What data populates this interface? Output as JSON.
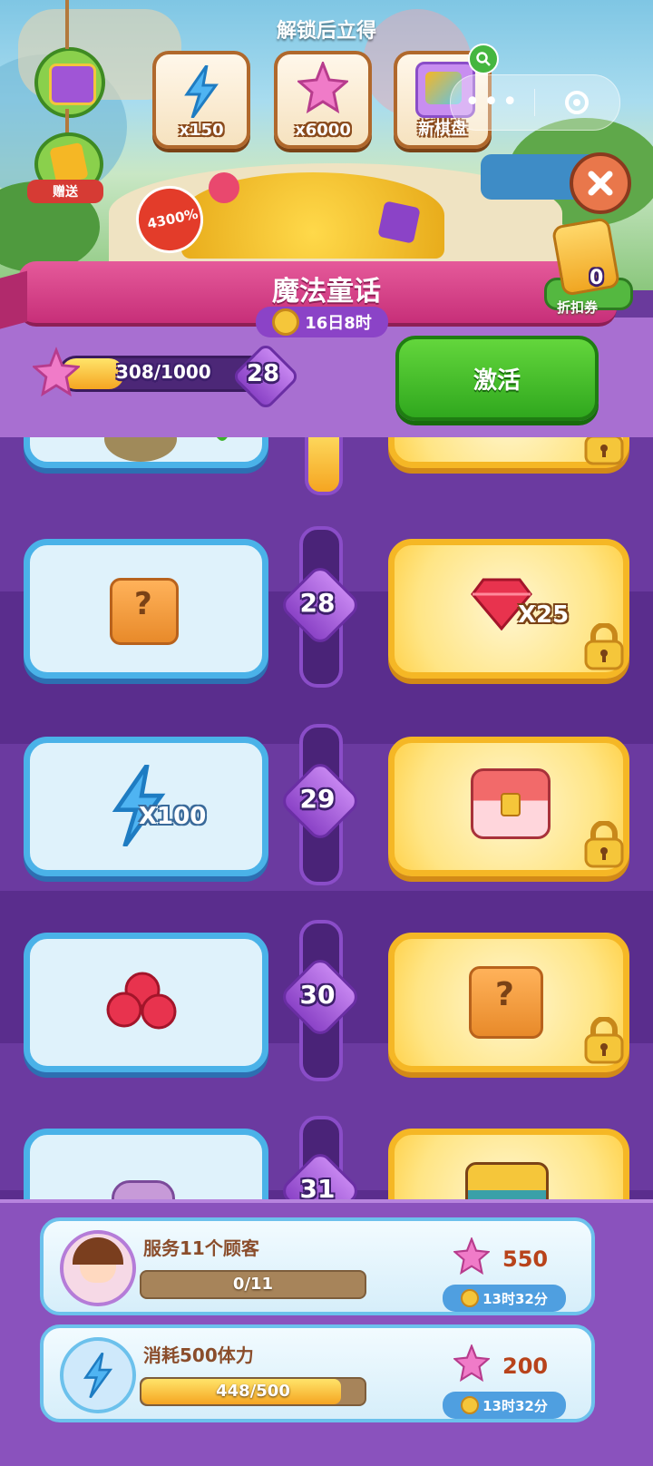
{
  "unlock": {
    "title": "解锁后立得",
    "rewards": [
      {
        "label": "x150",
        "icon": "lightning-icon"
      },
      {
        "label": "x6000",
        "icon": "star-icon"
      },
      {
        "label": "新棋盘",
        "icon": "new-board-icon"
      }
    ],
    "gift_label": "赠送",
    "discount_badge": "4300%"
  },
  "coupon": {
    "count": "0",
    "label": "折扣券"
  },
  "banner": {
    "title": "魔法童话",
    "time_left": "16日8时"
  },
  "progress": {
    "current": 308,
    "max": 1000,
    "text": "308/1000",
    "fraction": 0.308,
    "level": "28"
  },
  "activate_button": "激活",
  "levels": [
    {
      "level": "28",
      "free_reward": "mystery-box",
      "premium_reward": "gem",
      "premium_label": "X25"
    },
    {
      "level": "29",
      "free_reward": "lightning",
      "free_label": "X100",
      "premium_reward": "chest"
    },
    {
      "level": "30",
      "free_reward": "gems",
      "premium_reward": "mystery-box"
    },
    {
      "level": "31",
      "free_reward": "chest-purple",
      "premium_reward": "treasure-chest"
    }
  ],
  "tasks": [
    {
      "title": "服务11个顾客",
      "progress_text": "0/11",
      "fraction": 0.0,
      "reward": "550",
      "timer": "13时32分"
    },
    {
      "title": "消耗500体力",
      "progress_text": "448/500",
      "fraction": 0.896,
      "reward": "200",
      "timer": "13时32分"
    }
  ],
  "colors": {
    "accent_green": "#3cb22a",
    "banner_pink": "#d23f86",
    "panel_purple": "#a86fd1"
  }
}
